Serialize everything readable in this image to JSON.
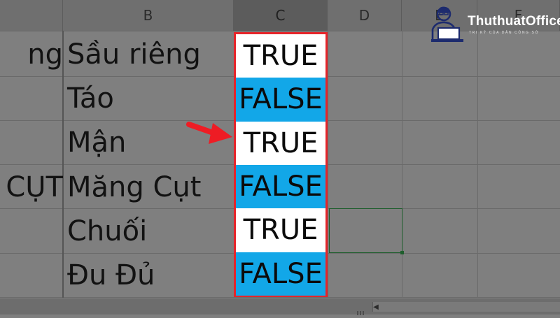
{
  "columns": {
    "B": "B",
    "C": "C",
    "D": "D",
    "E": "E",
    "F": "F"
  },
  "rows": [
    {
      "a": "ng",
      "b": "Sầu riêng",
      "c": "TRUE",
      "type": "true"
    },
    {
      "a": "",
      "b": "Táo",
      "c": "FALSE",
      "type": "false"
    },
    {
      "a": "",
      "b": "Mận",
      "c": "TRUE",
      "type": "true"
    },
    {
      "a": "CỤT",
      "b": "Măng Cụt",
      "c": "FALSE",
      "type": "false"
    },
    {
      "a": "",
      "b": "Chuối",
      "c": "TRUE",
      "type": "true"
    },
    {
      "a": "",
      "b": "Đu Đủ",
      "c": "FALSE",
      "type": "false"
    }
  ],
  "logo": {
    "name": "ThuthuatOffice",
    "tagline": "TRI KỶ CỦA DÂN CÔNG SỞ"
  },
  "colors": {
    "highlight_border": "#e5252a",
    "false_fill": "#12a7e8",
    "true_fill": "#ffffff",
    "arrow": "#ee1c24"
  },
  "icons": {
    "arrow": "right-arrow-icon",
    "logo": "person-laptop-icon",
    "scroll_left": "scroll-left-icon"
  }
}
